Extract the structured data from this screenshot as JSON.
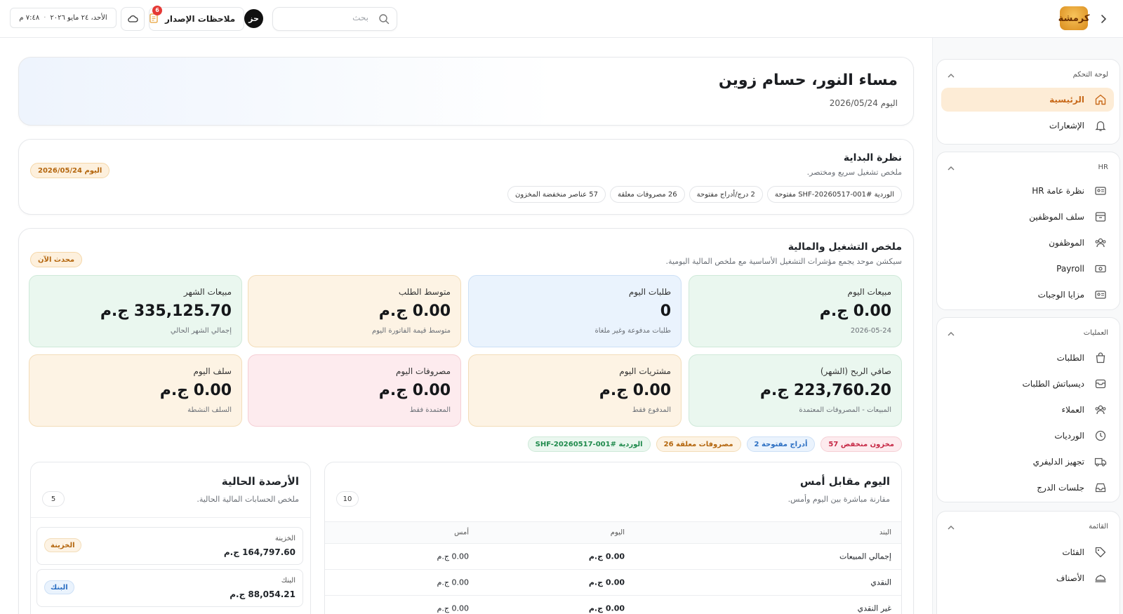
{
  "topbar": {
    "logo_text": "كرمشة",
    "search_placeholder": "بحث",
    "avatar_initials": "حز",
    "release_notes_label": "ملاحظات الإصدار",
    "release_notes_count": "6",
    "date_text": "الأحد، ٢٤ مايو ٢٠٢٦",
    "time_text": "٧:٤٨ م"
  },
  "sidebar": {
    "groups": [
      {
        "title": "لوحة التحكم",
        "items": [
          {
            "label": "الرئيسية",
            "icon": "home-icon",
            "active": true
          },
          {
            "label": "الإشعارات",
            "icon": "bell-icon",
            "active": false
          }
        ]
      },
      {
        "title": "HR",
        "items": [
          {
            "label": "نظرة عامة HR",
            "icon": "id-card-icon"
          },
          {
            "label": "سلف الموظفين",
            "icon": "archive-icon"
          },
          {
            "label": "الموظفون",
            "icon": "users-icon"
          },
          {
            "label": "Payroll",
            "icon": "banknote-icon"
          },
          {
            "label": "مزايا الوجبات",
            "icon": "id-card-icon"
          }
        ]
      },
      {
        "title": "العمليات",
        "items": [
          {
            "label": "الطلبات",
            "icon": "bag-icon"
          },
          {
            "label": "ديسباتش الطلبات",
            "icon": "layers-icon"
          },
          {
            "label": "العملاء",
            "icon": "users-icon"
          },
          {
            "label": "الورديات",
            "icon": "clock-icon"
          },
          {
            "label": "تجهيز الدليفري",
            "icon": "truck-icon"
          },
          {
            "label": "جلسات الدرج",
            "icon": "inbox-icon"
          }
        ]
      },
      {
        "title": "القائمة",
        "items": [
          {
            "label": "الفئات",
            "icon": "tag-icon"
          },
          {
            "label": "الأصناف",
            "icon": "dish-icon"
          }
        ]
      }
    ]
  },
  "greeting": {
    "title": "مساء النور، حسام زوين",
    "date": "اليوم 2026/05/24"
  },
  "start_view": {
    "title": "نظرة البداية",
    "subtitle": "ملخص تشغيل سريع ومختصر.",
    "date_pill": "اليوم 2026/05/24",
    "pills": [
      "الوردية #SHF-20260517-001 مفتوحة",
      "2 درج/أدراج مفتوحة",
      "26 مصروفات معلقة",
      "57 عناصر منخفضة المخزون"
    ]
  },
  "summary": {
    "title": "ملخص التشغيل والمالية",
    "subtitle": "سيكشن موحد يجمع مؤشرات التشغيل الأساسية مع ملخص المالية اليومية.",
    "updated_pill": "محدث الآن",
    "kpis": [
      {
        "title": "مبيعات اليوم",
        "value": "0.00 ج.م",
        "note": "2026-05-24",
        "color": "green"
      },
      {
        "title": "طلبات اليوم",
        "value": "0",
        "note": "طلبات مدفوعة وغير ملغاة",
        "color": "blue"
      },
      {
        "title": "متوسط الطلب",
        "value": "0.00 ج.م",
        "note": "متوسط قيمة الفاتورة اليوم",
        "color": "orange"
      },
      {
        "title": "مبيعات الشهر",
        "value": "335,125.70 ج.م",
        "note": "إجمالي الشهر الحالي",
        "color": "green"
      },
      {
        "title": "صافي الربح (الشهر)",
        "value": "223,760.20 ج.م",
        "note": "المبيعات - المصروفات المعتمدة",
        "color": "green"
      },
      {
        "title": "مشتريات اليوم",
        "value": "0.00 ج.م",
        "note": "المدفوع فقط",
        "color": "orange"
      },
      {
        "title": "مصروفات اليوم",
        "value": "0.00 ج.م",
        "note": "المعتمدة فقط",
        "color": "red"
      },
      {
        "title": "سلف اليوم",
        "value": "0.00 ج.م",
        "note": "السلف النشطة",
        "color": "orange"
      }
    ],
    "tags": [
      {
        "label": "مخزون منخفض 57",
        "color": "red"
      },
      {
        "label": "أدراج مفتوحة 2",
        "color": "blue"
      },
      {
        "label": "مصروفات معلقة 26",
        "color": "orange"
      },
      {
        "label": "الوردية #SHF-20260517-001",
        "color": "green"
      }
    ]
  },
  "compare": {
    "title": "اليوم مقابل أمس",
    "subtitle": "مقارنة مباشرة بين اليوم وأمس.",
    "count": "10",
    "headers": [
      "البند",
      "اليوم",
      "أمس"
    ],
    "rows": [
      [
        "إجمالي المبيعات",
        "0.00 ج.م",
        "0.00 ج.م"
      ],
      [
        "النقدي",
        "0.00 ج.م",
        "0.00 ج.م"
      ],
      [
        "غير النقدي",
        "0.00 ج.م",
        "0.00 ج.م"
      ]
    ]
  },
  "balances": {
    "title": "الأرصدة الحالية",
    "subtitle": "ملخص الحسابات المالية الحالية.",
    "count": "5",
    "items": [
      {
        "name": "الخزينة",
        "value": "164,797.60 ج.م",
        "tag": "الخزينة",
        "color": "orange"
      },
      {
        "name": "البنك",
        "value": "88,054.21 ج.م",
        "tag": "البنك",
        "color": "blue"
      }
    ]
  }
}
